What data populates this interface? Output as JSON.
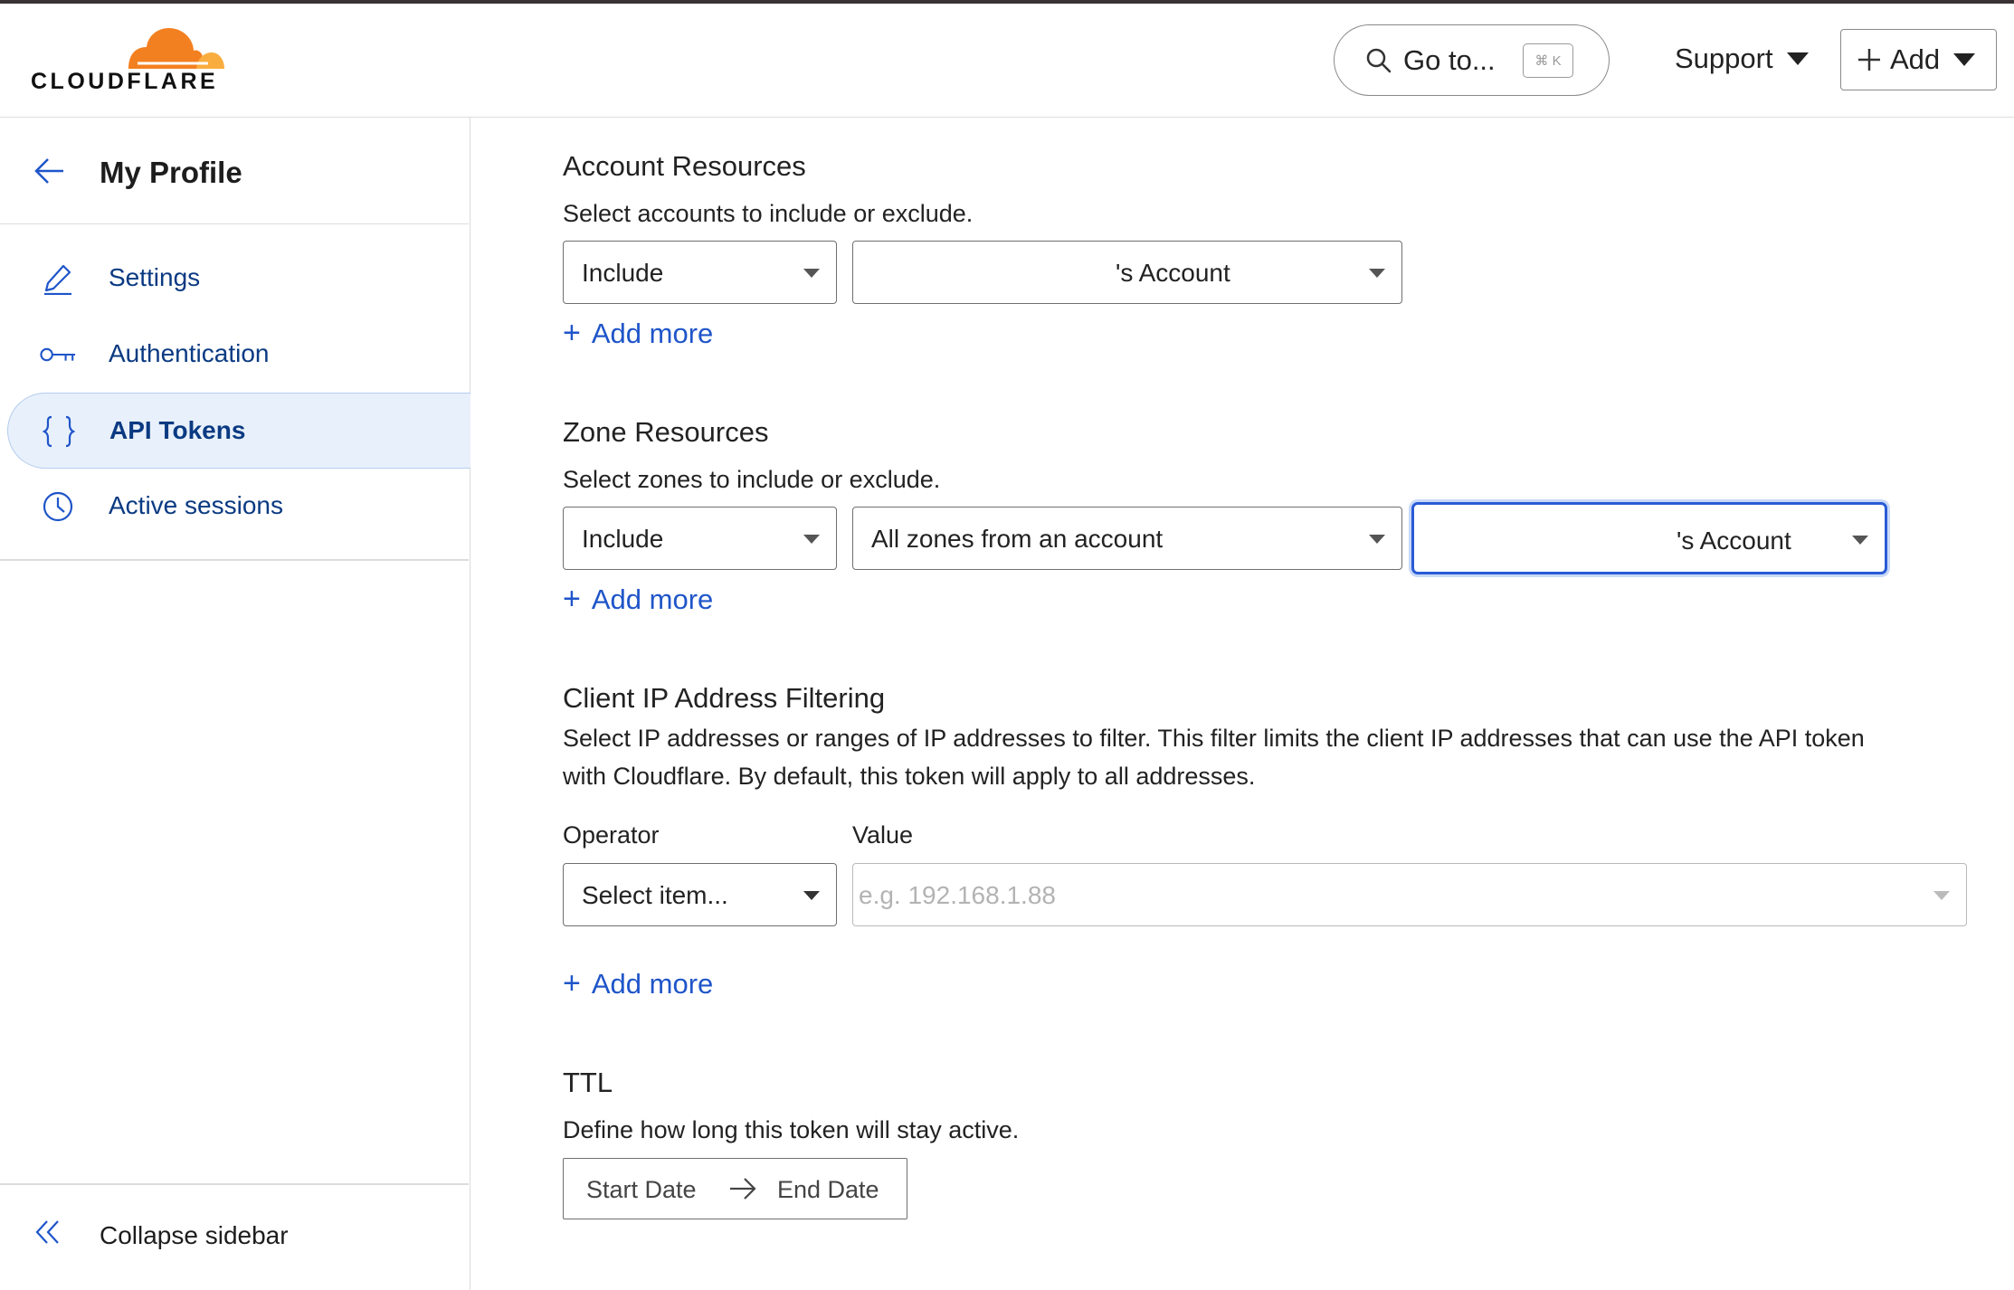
{
  "brand": {
    "logo_text": "CLOUDFLARE",
    "orange": "#F38020",
    "light_orange": "#FAAD3F"
  },
  "header": {
    "goto_label": "Go to...",
    "shortcut": "⌘ K",
    "support_label": "Support",
    "add_label": "Add"
  },
  "sidebar": {
    "title": "My Profile",
    "items": [
      {
        "label": "Settings",
        "icon": "pencil-icon",
        "active": false
      },
      {
        "label": "Authentication",
        "icon": "key-icon",
        "active": false
      },
      {
        "label": "API Tokens",
        "icon": "braces-icon",
        "active": true
      },
      {
        "label": "Active sessions",
        "icon": "clock-icon",
        "active": false
      }
    ],
    "collapse_label": "Collapse sidebar"
  },
  "account_resources": {
    "title": "Account Resources",
    "description": "Select accounts to include or exclude.",
    "operator": "Include",
    "account": "'s Account",
    "add_more": "Add more"
  },
  "zone_resources": {
    "title": "Zone Resources",
    "description": "Select zones to include or exclude.",
    "operator": "Include",
    "scope": "All zones from an account",
    "account": "'s Account",
    "add_more": "Add more"
  },
  "ip_filtering": {
    "title": "Client IP Address Filtering",
    "description_line1": "Select IP addresses or ranges of IP addresses to filter. This filter limits the client IP addresses that can use the API token",
    "description_line2": "with Cloudflare. By default, this token will apply to all addresses.",
    "operator_label": "Operator",
    "value_label": "Value",
    "operator_placeholder": "Select item...",
    "value_placeholder": "e.g. 192.168.1.88",
    "add_more": "Add more"
  },
  "ttl": {
    "title": "TTL",
    "description": "Define how long this token will stay active.",
    "start_label": "Start Date",
    "end_label": "End Date"
  },
  "colors": {
    "link_blue": "#1f55c9",
    "nav_blue": "#0a3a82",
    "active_bg": "#e8f0fb",
    "focus_ring": "#2a5bd6"
  }
}
